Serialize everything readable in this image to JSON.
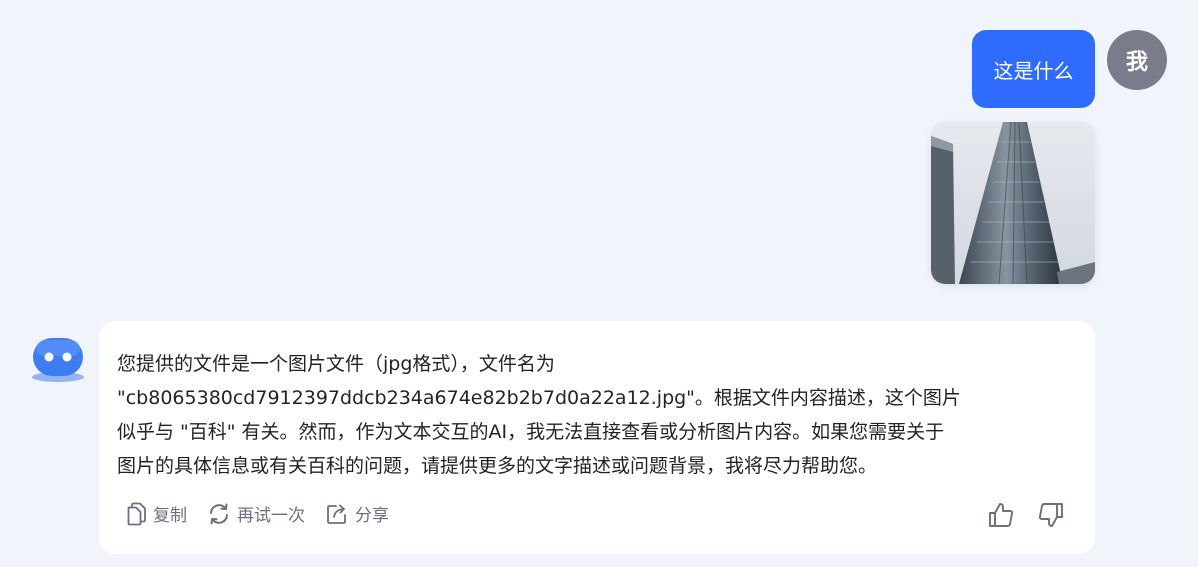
{
  "user": {
    "message": "这是什么",
    "avatar_label": "我",
    "attachment_icon": "skyscraper-photo"
  },
  "bot": {
    "avatar_icon": "bot-face-icon",
    "reply_line1": "您提供的文件是一个图片文件（jpg格式），文件名为",
    "reply_line2": "\"cb8065380cd7912397ddcb234a674e82b2b7d0a22a12.jpg\"。根据文件内容描述，这个图片",
    "reply_line3": "似乎与 \"百科\" 有关。然而，作为文本交互的AI，我无法直接查看或分析图片内容。如果您需要关于",
    "reply_line4": "图片的具体信息或有关百科的问题，请提供更多的文字描述或问题背景，我将尽力帮助您。",
    "actions": {
      "copy_label": "复制",
      "retry_label": "再试一次",
      "share_label": "分享"
    }
  },
  "colors": {
    "background": "#f1f4fb",
    "user_bubble": "#2f6bff",
    "user_avatar": "#7a7c8c",
    "bot_avatar": "#3d7cf2",
    "action_text": "#6a7080"
  }
}
